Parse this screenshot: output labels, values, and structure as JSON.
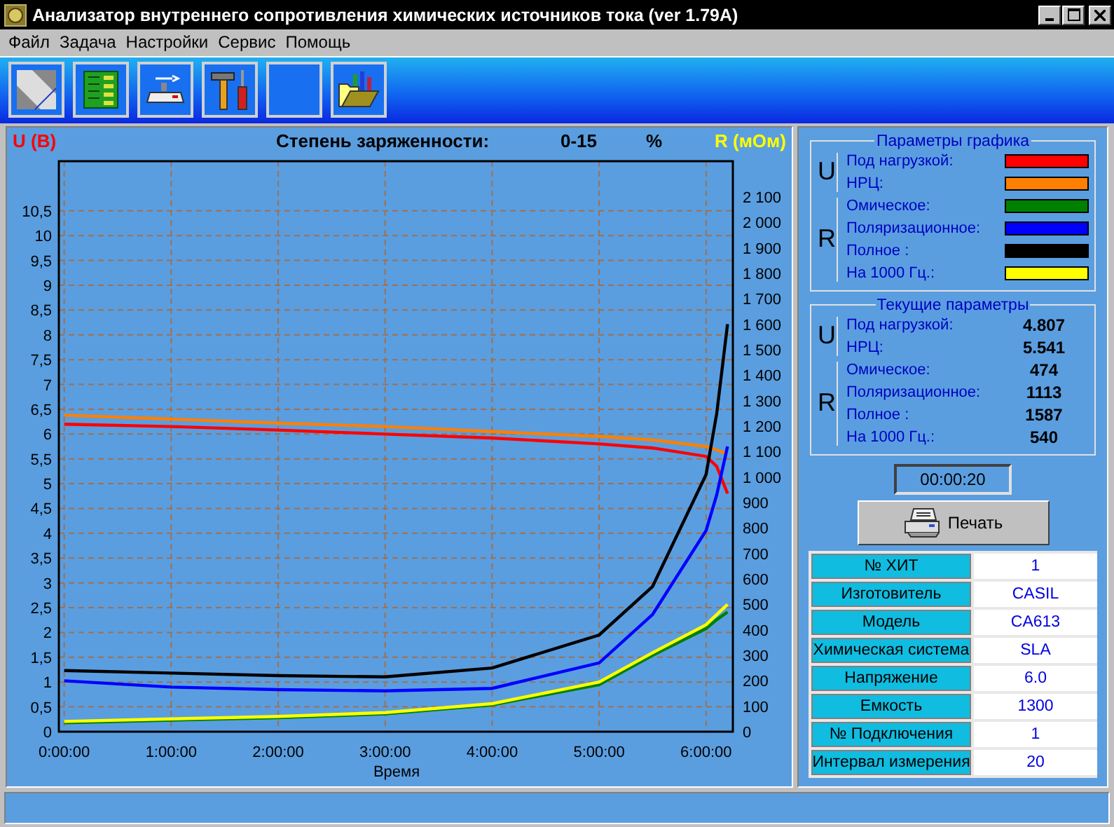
{
  "window": {
    "title": "Анализатор внутреннего сопротивления химических источников тока (ver 1.79A)"
  },
  "menu": [
    "Файл",
    "Задача",
    "Настройки",
    "Сервис",
    "Помощь"
  ],
  "toolbar": [
    {
      "kind": "image"
    },
    {
      "kind": "board"
    },
    {
      "kind": "scale"
    },
    {
      "kind": "tools"
    },
    {
      "kind": "blank"
    },
    {
      "kind": "folder"
    }
  ],
  "chart": {
    "charge_label": "Степень заряженности:",
    "charge_value": "0-15",
    "charge_unit": "%",
    "chart_data": {
      "type": "line",
      "grid": true,
      "xlabel": "Время",
      "ylabel": "U (В)",
      "y2label": "R (мОм)",
      "x": [
        0,
        1,
        2,
        3,
        4,
        5,
        5.5,
        6,
        6.1,
        6.2
      ],
      "xlim": [
        -0.05,
        6.25
      ],
      "ylim": [
        0,
        11.5
      ],
      "y2lim": [
        0,
        2240
      ],
      "xticks": [
        {
          "value": 0,
          "label": "0:00:00"
        },
        {
          "value": 1,
          "label": "1:00:00"
        },
        {
          "value": 2,
          "label": "2:00:00"
        },
        {
          "value": 3,
          "label": "3:00:00"
        },
        {
          "value": 4,
          "label": "4:00:00"
        },
        {
          "value": 5,
          "label": "5:00:00"
        },
        {
          "value": 6,
          "label": "6:00:00"
        }
      ],
      "yticks": [
        0,
        {
          "value": 0.5,
          "label": "0,5"
        },
        1,
        {
          "value": 1.5,
          "label": "1,5"
        },
        2,
        {
          "value": 2.5,
          "label": "2,5"
        },
        3,
        {
          "value": 3.5,
          "label": "3,5"
        },
        4,
        {
          "value": 4.5,
          "label": "4,5"
        },
        5,
        {
          "value": 5.5,
          "label": "5,5"
        },
        6,
        {
          "value": 6.5,
          "label": "6,5"
        },
        7,
        {
          "value": 7.5,
          "label": "7,5"
        },
        8,
        {
          "value": 8.5,
          "label": "8,5"
        },
        9,
        {
          "value": 9.5,
          "label": "9,5"
        },
        10,
        {
          "value": 10.5,
          "label": "10,5"
        }
      ],
      "y2ticks": [
        0,
        100,
        200,
        300,
        400,
        500,
        600,
        700,
        800,
        900,
        {
          "value": 1000,
          "label": "1 000"
        },
        {
          "value": 1100,
          "label": "1 100"
        },
        {
          "value": 1200,
          "label": "1 200"
        },
        {
          "value": 1300,
          "label": "1 300"
        },
        {
          "value": 1400,
          "label": "1 400"
        },
        {
          "value": 1500,
          "label": "1 500"
        },
        {
          "value": 1600,
          "label": "1 600"
        },
        {
          "value": 1700,
          "label": "1 700"
        },
        {
          "value": 1800,
          "label": "1 800"
        },
        {
          "value": 1900,
          "label": "1 900"
        },
        {
          "value": 2000,
          "label": "2 000"
        },
        {
          "value": 2100,
          "label": "2 100"
        }
      ],
      "series": [
        {
          "color": "#ff0000",
          "values": [
            6.2,
            6.15,
            6.08,
            6.0,
            5.92,
            5.8,
            5.72,
            5.55,
            5.35,
            4.8
          ]
        },
        {
          "color": "#ff8000",
          "values": [
            6.38,
            6.3,
            6.22,
            6.15,
            6.05,
            5.95,
            5.88,
            5.75,
            5.68,
            5.6
          ]
        },
        {
          "axis": "y2",
          "color": "#008000",
          "values": [
            35,
            45,
            55,
            70,
            105,
            185,
            300,
            405,
            440,
            470
          ]
        },
        {
          "axis": "y2",
          "color": "#0000ff",
          "values": [
            200,
            175,
            165,
            160,
            170,
            270,
            460,
            790,
            930,
            1120
          ]
        },
        {
          "axis": "y2",
          "color": "#000000",
          "values": [
            240,
            230,
            220,
            215,
            250,
            380,
            570,
            1010,
            1250,
            1600
          ]
        },
        {
          "axis": "y2",
          "color": "#ffff00",
          "values": [
            40,
            50,
            60,
            75,
            110,
            195,
            310,
            420,
            460,
            500
          ]
        }
      ]
    }
  },
  "plot_params": {
    "title": "Параметры графика",
    "groups": [
      {
        "letter": "U",
        "items": [
          {
            "label": "Под нагрузкой:",
            "color": "#ff0000"
          },
          {
            "label": "НРЦ:",
            "color": "#ff8000"
          }
        ]
      },
      {
        "letter": "R",
        "items": [
          {
            "label": "Омическое:",
            "color": "#008000"
          },
          {
            "label": "Поляризационное:",
            "color": "#0000ff"
          },
          {
            "label": "Полное :",
            "color": "#000000"
          },
          {
            "label": "На 1000 Гц.:",
            "color": "#ffff00"
          }
        ]
      }
    ]
  },
  "current_params": {
    "title": "Текущие параметры",
    "groups": [
      {
        "letter": "U",
        "items": [
          {
            "label": "Под нагрузкой:",
            "value": "4.807"
          },
          {
            "label": "НРЦ:",
            "value": "5.541"
          }
        ]
      },
      {
        "letter": "R",
        "items": [
          {
            "label": "Омическое:",
            "value": "474"
          },
          {
            "label": "Поляризационное:",
            "value": "1113"
          },
          {
            "label": "Полное :",
            "value": "1587"
          },
          {
            "label": "На 1000 Гц.:",
            "value": "540"
          }
        ]
      }
    ]
  },
  "timer": "00:00:20",
  "print_button": "Печать",
  "info_table": [
    {
      "label": "№ ХИТ",
      "value": "1"
    },
    {
      "label": "Изготовитель",
      "value": "CASIL"
    },
    {
      "label": "Модель",
      "value": "CA613"
    },
    {
      "label": "Химическая система",
      "value": "SLA"
    },
    {
      "label": "Напряжение",
      "value": "6.0"
    },
    {
      "label": "Емкость",
      "value": "1300"
    },
    {
      "label": "№ Подключения",
      "value": "1"
    },
    {
      "label": "Интервал измерения",
      "value": "20"
    }
  ]
}
